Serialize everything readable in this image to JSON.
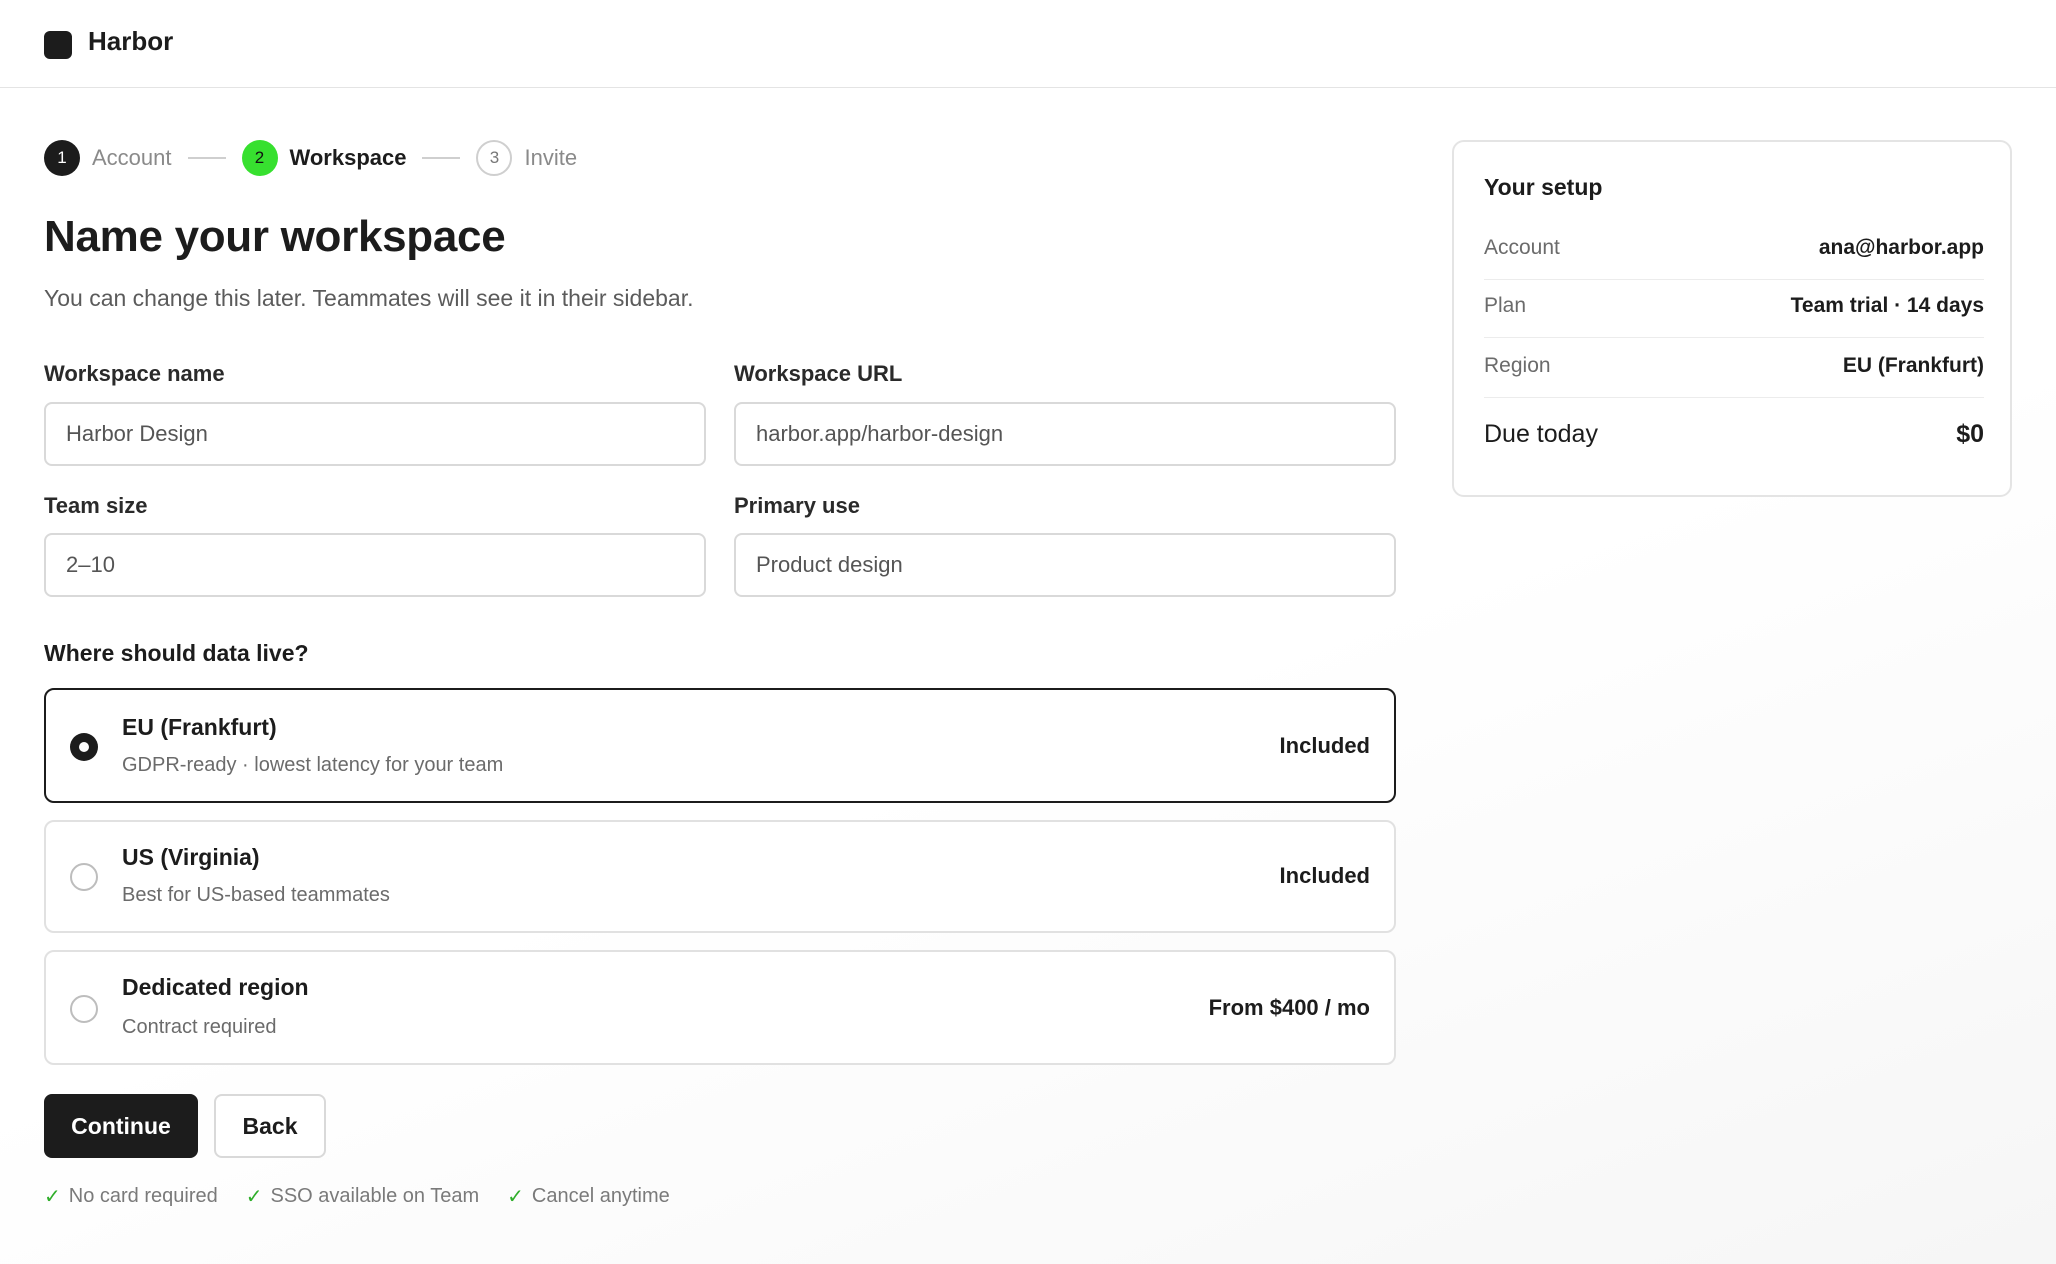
{
  "app": {
    "name": "Harbor"
  },
  "stepper": {
    "steps": [
      {
        "number": "1",
        "label": "Account",
        "state": "done"
      },
      {
        "number": "2",
        "label": "Workspace",
        "state": "active"
      },
      {
        "number": "3",
        "label": "Invite",
        "state": "todo"
      }
    ]
  },
  "page": {
    "title": "Name your workspace",
    "subtitle": "You can change this later. Teammates will see it in their sidebar."
  },
  "form": {
    "workspace_name": {
      "label": "Workspace name",
      "value": "Harbor Design"
    },
    "workspace_url": {
      "label": "Workspace URL",
      "value": "harbor.app/harbor-design"
    },
    "team_size": {
      "label": "Team size",
      "value": "2–10"
    },
    "primary_use": {
      "label": "Primary use",
      "value": "Product design"
    }
  },
  "region": {
    "label": "Where should data live?",
    "options": [
      {
        "title": "EU (Frankfurt)",
        "description": "GDPR-ready · lowest latency for your team",
        "price": "Included",
        "selected": true
      },
      {
        "title": "US (Virginia)",
        "description": "Best for US-based teammates",
        "price": "Included",
        "selected": false
      },
      {
        "title": "Dedicated region",
        "description": "Contract required",
        "price": "From $400 / mo",
        "selected": false
      }
    ]
  },
  "actions": {
    "continue_label": "Continue",
    "back_label": "Back"
  },
  "perks": [
    "No card required",
    "SSO available on Team",
    "Cancel anytime"
  ],
  "summary": {
    "title": "Your setup",
    "rows": [
      {
        "key": "Account",
        "value": "ana@harbor.app"
      },
      {
        "key": "Plan",
        "value": "Team trial · 14 days"
      },
      {
        "key": "Region",
        "value": "EU (Frankfurt)"
      }
    ],
    "due_label": "Due today",
    "due_value": "$0"
  },
  "colors": {
    "accent_green": "#37e02f",
    "dark": "#1c1c1c",
    "check_green": "#2fae2a"
  }
}
